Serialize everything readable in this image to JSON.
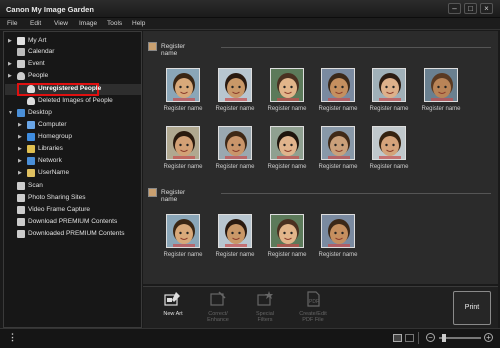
{
  "window": {
    "title": "Canon My Image Garden"
  },
  "menu": [
    "File",
    "Edit",
    "View",
    "Image",
    "Tools",
    "Help"
  ],
  "sidebar": {
    "items": [
      {
        "label": "My Art",
        "icon": "my-art-icon",
        "indent": 0,
        "arrow": "▶"
      },
      {
        "label": "Calendar",
        "icon": "calendar-icon",
        "indent": 0,
        "arrow": ""
      },
      {
        "label": "Event",
        "icon": "event-icon",
        "indent": 0,
        "arrow": "▶"
      },
      {
        "label": "People",
        "icon": "people-icon",
        "indent": 0,
        "arrow": "▶"
      },
      {
        "label": "Unregistered People",
        "icon": "person-icon",
        "indent": 1,
        "arrow": ""
      },
      {
        "label": "Deleted Images of People",
        "icon": "person-icon",
        "indent": 1,
        "arrow": ""
      },
      {
        "label": "Desktop",
        "icon": "desktop-icon",
        "indent": 0,
        "arrow": "▼"
      },
      {
        "label": "Computer",
        "icon": "computer-icon",
        "indent": 1,
        "arrow": "▶"
      },
      {
        "label": "Homegroup",
        "icon": "homegroup-icon",
        "indent": 1,
        "arrow": "▶"
      },
      {
        "label": "Libraries",
        "icon": "libraries-icon",
        "indent": 1,
        "arrow": "▶"
      },
      {
        "label": "Network",
        "icon": "network-icon",
        "indent": 1,
        "arrow": "▶"
      },
      {
        "label": "UserName",
        "icon": "user-folder-icon",
        "indent": 1,
        "arrow": "▶"
      },
      {
        "label": "Scan",
        "icon": "scan-icon",
        "indent": 0,
        "arrow": ""
      },
      {
        "label": "Photo Sharing Sites",
        "icon": "photo-sharing-icon",
        "indent": 0,
        "arrow": ""
      },
      {
        "label": "Video Frame Capture",
        "icon": "video-frame-icon",
        "indent": 0,
        "arrow": ""
      },
      {
        "label": "Download PREMIUM Contents",
        "icon": "download-icon",
        "indent": 0,
        "arrow": ""
      },
      {
        "label": "Downloaded PREMIUM Contents",
        "icon": "folder-icon",
        "indent": 0,
        "arrow": ""
      }
    ],
    "selected_index": 4
  },
  "groups": [
    {
      "label": "Register name",
      "thumb_labels": [
        "Register name",
        "Register name",
        "Register name",
        "Register name",
        "Register name",
        "Register name",
        "Register name",
        "Register name",
        "Register name",
        "Register name",
        "Register name"
      ]
    },
    {
      "label": "Register name",
      "thumb_labels": [
        "Register name",
        "Register name",
        "Register name",
        "Register name"
      ]
    }
  ],
  "toolbar": {
    "new_art": "New Art",
    "correct_enhance": "Correct/\nEnhance",
    "special_filters": "Special\nFilters",
    "create_edit_pdf": "Create/Edit\nPDF File",
    "print": "Print"
  },
  "colors": {
    "highlight": "#e01010",
    "background": "#2b2b2b"
  }
}
